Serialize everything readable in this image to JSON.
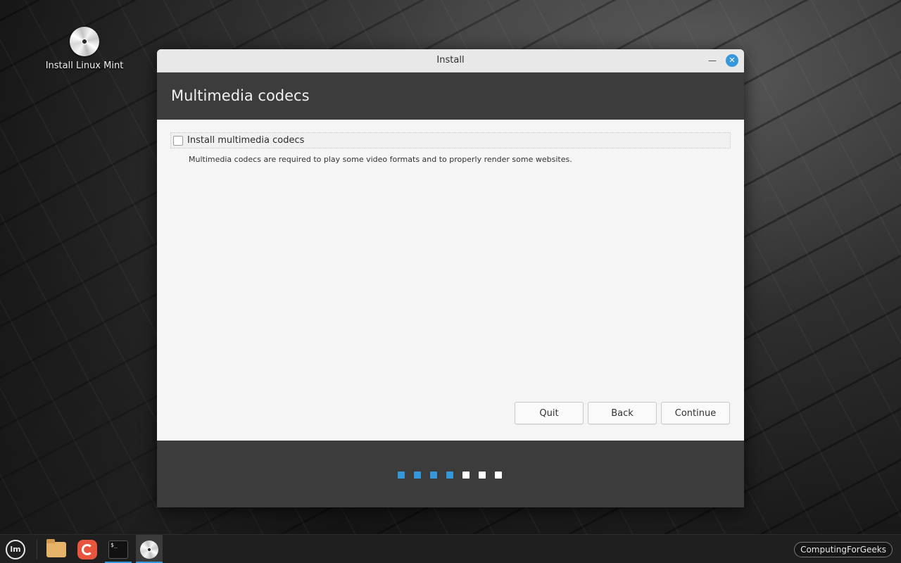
{
  "desktop": {
    "icon_label": "Install Linux Mint"
  },
  "window": {
    "title": "Install",
    "minimize_glyph": "—",
    "close_glyph": "✕",
    "page_heading": "Multimedia codecs",
    "checkbox_label": "Install multimedia codecs",
    "checkbox_checked": false,
    "description": "Multimedia codecs are required to play some video formats and to properly render some websites.",
    "buttons": {
      "quit": "Quit",
      "back": "Back",
      "continue": "Continue"
    },
    "progress": {
      "total_steps": 7,
      "completed_steps": 4,
      "active_color": "#3498db",
      "inactive_color": "#ffffff"
    }
  },
  "taskbar": {
    "menu_glyph": "lm",
    "terminal_glyph": "$_",
    "watermark": "ComputingForGeeks",
    "accent_color": "#3498db"
  }
}
